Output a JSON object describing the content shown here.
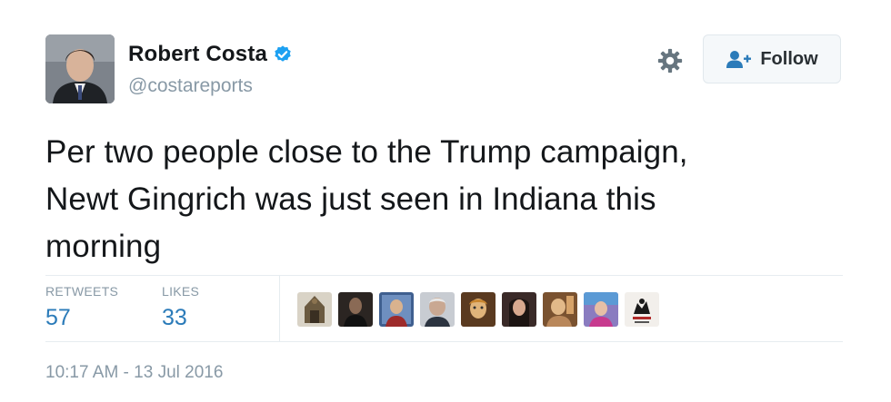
{
  "user": {
    "name": "Robert Costa",
    "handle": "@costareports",
    "verified": true,
    "avatar_icon": "profile-photo"
  },
  "actions": {
    "settings_icon": "gear-icon",
    "follow_label": "Follow",
    "follow_icon": "add-user-icon"
  },
  "tweet": {
    "lines": [
      "Per two people close to the Trump campaign,",
      "Newt Gingrich was just seen in Indiana this",
      "morning"
    ]
  },
  "stats": {
    "retweets_label": "RETWEETS",
    "retweets_count": "57",
    "likes_label": "LIKES",
    "likes_count": "33"
  },
  "likers": [
    {
      "icon": "liker-avatar-1",
      "color": "#9a8a70"
    },
    {
      "icon": "liker-avatar-2",
      "color": "#2b2522"
    },
    {
      "icon": "liker-avatar-3",
      "color": "#4b6a9a"
    },
    {
      "icon": "liker-avatar-4",
      "color": "#6f7684"
    },
    {
      "icon": "liker-avatar-5",
      "color": "#b58a58"
    },
    {
      "icon": "liker-avatar-6",
      "color": "#3a2a28"
    },
    {
      "icon": "liker-avatar-7",
      "color": "#b9875a"
    },
    {
      "icon": "liker-avatar-8",
      "color": "#6a5a9a"
    },
    {
      "icon": "liker-avatar-9",
      "color": "#e8e4e0"
    }
  ],
  "timestamp": "10:17 AM - 13 Jul 2016",
  "colors": {
    "accent": "#2b7bb9",
    "verified": "#1da1f2",
    "muted": "#8899a6"
  }
}
